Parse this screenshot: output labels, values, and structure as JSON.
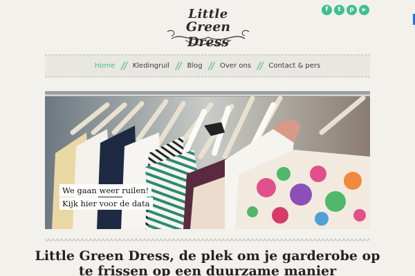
{
  "brand": {
    "line1": "Little",
    "line2": "Green Dress"
  },
  "social": [
    {
      "name": "facebook-icon",
      "glyph": "f"
    },
    {
      "name": "twitter-icon",
      "glyph": "t"
    },
    {
      "name": "pinterest-icon",
      "glyph": "p"
    },
    {
      "name": "youtube-icon",
      "glyph": "▶"
    }
  ],
  "nav": {
    "items": [
      {
        "label": "Home",
        "active": true
      },
      {
        "label": "Kledingruil",
        "active": false
      },
      {
        "label": "Blog",
        "active": false
      },
      {
        "label": "Over ons",
        "active": false
      },
      {
        "label": "Contact & pers",
        "active": false
      }
    ],
    "separator": "//"
  },
  "hero": {
    "caption_line1": "We gaan weer ruilen!",
    "caption_line2": "Kijk hier voor de data"
  },
  "headline": "Little Green Dress, de plek om je garderobe op te frissen op een duurzame manier",
  "colors": {
    "accent": "#3fbf8f",
    "background": "#f2f1ec",
    "nav_bg": "#e8e7e1"
  }
}
